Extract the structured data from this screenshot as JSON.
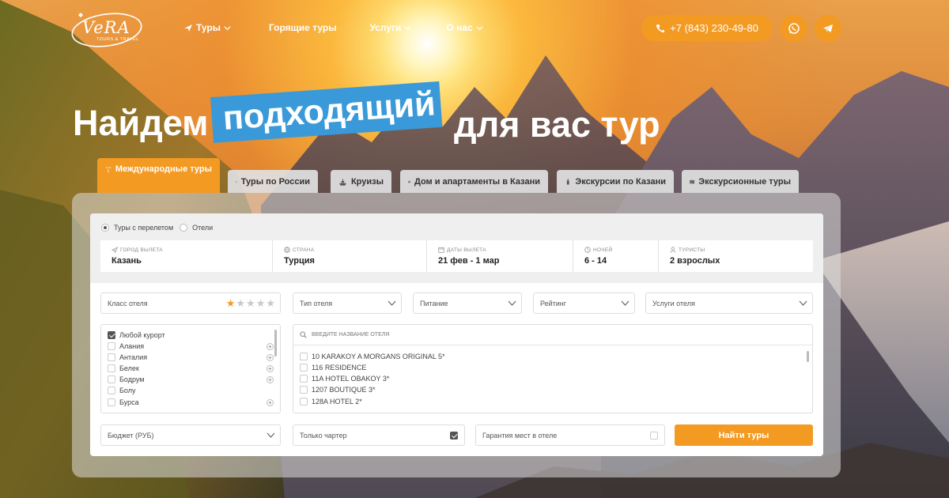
{
  "colors": {
    "accent": "#f39a23",
    "highlight": "#3a9ad9",
    "text_dark": "#222222"
  },
  "logo": {
    "text": "VeRA",
    "sub": "TOURS & TRAVEL"
  },
  "nav": [
    {
      "label": "Туры",
      "icon": "plane-icon",
      "dropdown": true
    },
    {
      "label": "Горящие туры",
      "dropdown": false
    },
    {
      "label": "Услуги",
      "dropdown": true
    },
    {
      "label": "О нас",
      "dropdown": true
    }
  ],
  "header": {
    "phone": "+7 (843) 230-49-80",
    "whatsapp_icon": "whatsapp-icon",
    "telegram_icon": "telegram-icon"
  },
  "hero": {
    "part1": "Найдем",
    "highlight": "подходящий",
    "part2": "для вас тур"
  },
  "tabs": [
    {
      "label": "Международные туры",
      "icon": "palm-icon",
      "active": true
    },
    {
      "label": "Туры по России",
      "icon": "house-icon",
      "active": false
    },
    {
      "label": "Круизы",
      "icon": "ship-icon",
      "active": false
    },
    {
      "label": "Дом и апартаменты в Казани",
      "icon": "building-icon",
      "active": false
    },
    {
      "label": "Экскурсии по Казани",
      "icon": "kremlin-icon",
      "active": false
    },
    {
      "label": "Экскурсионные туры",
      "icon": "map-icon",
      "active": false
    }
  ],
  "search": {
    "mode_options": [
      {
        "label": "Туры с перелетом",
        "selected": true
      },
      {
        "label": "Отели",
        "selected": false
      }
    ],
    "departure": {
      "label": "Город вылета",
      "value": "Казань"
    },
    "country": {
      "label": "Страна",
      "value": "Турция"
    },
    "dates": {
      "label": "Даты вылета",
      "value": "21 фев - 1 мар"
    },
    "nights": {
      "label": "Ночей",
      "value": "6 - 14"
    },
    "tourists": {
      "label": "Туристы",
      "value": "2 взрослых"
    }
  },
  "filters": {
    "hotel_class": {
      "label": "Класс отеля",
      "stars_selected": 1,
      "stars_total": 5
    },
    "hotel_type": "Тип отеля",
    "meal": "Питание",
    "rating": "Рейтинг",
    "services": "Услуги отеля"
  },
  "resorts": [
    {
      "label": "Любой курорт",
      "checked": true,
      "plus": false
    },
    {
      "label": "Алания",
      "checked": false,
      "plus": true
    },
    {
      "label": "Анталия",
      "checked": false,
      "plus": true
    },
    {
      "label": "Белек",
      "checked": false,
      "plus": true
    },
    {
      "label": "Бодрум",
      "checked": false,
      "plus": true
    },
    {
      "label": "Болу",
      "checked": false,
      "plus": false
    },
    {
      "label": "Бурса",
      "checked": false,
      "plus": true
    }
  ],
  "hotel_search": {
    "placeholder": "ВВЕДИТЕ НАЗВАНИЕ ОТЕЛЯ"
  },
  "hotels": [
    "10 KARAKOY A MORGANS ORIGINAL 5*",
    "116 RESIDENCE",
    "11A HOTEL OBAKOY 3*",
    "1207 BOUTIQUE 3*",
    "128A HOTEL 2*"
  ],
  "bottom": {
    "budget": "Бюджет (РУБ)",
    "charter_only": {
      "label": "Только чартер",
      "checked": true
    },
    "guarantee": {
      "label": "Гарантия мест в отеле",
      "checked": false
    },
    "find_button": "Найти туры"
  }
}
